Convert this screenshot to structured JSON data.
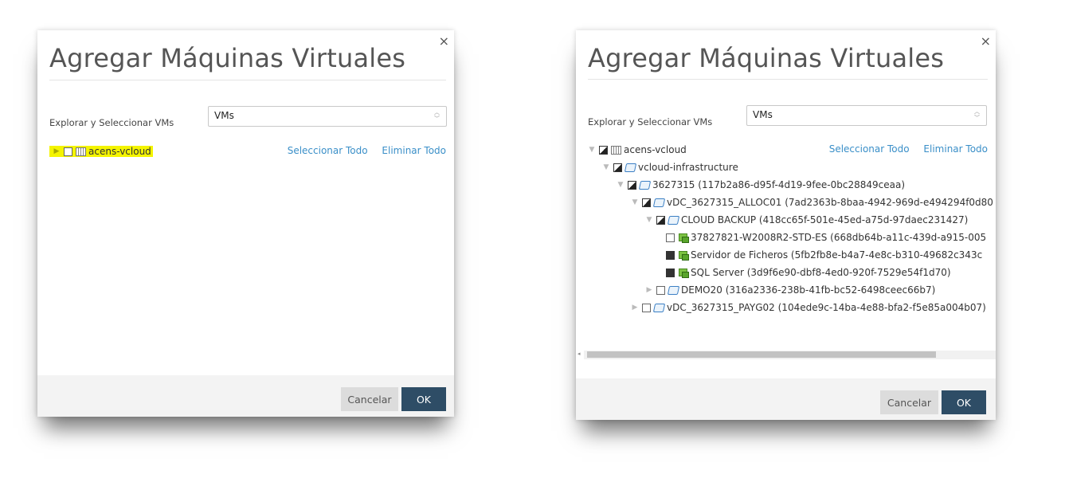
{
  "dialog_left": {
    "title": "Agregar Máquinas Virtuales",
    "close_label": "×",
    "field_label": "Explorar y Seleccionar VMs",
    "select_value": "VMs",
    "select_all": "Seleccionar Todo",
    "remove_all": "Eliminar Todo",
    "tree": [
      {
        "label": "acens-vcloud",
        "check": "empty",
        "expanded": false,
        "highlighted": true
      }
    ],
    "cancel": "Cancelar",
    "ok": "OK"
  },
  "dialog_right": {
    "title": "Agregar Máquinas Virtuales",
    "close_label": "×",
    "field_label": "Explorar y Seleccionar VMs",
    "select_value": "VMs",
    "select_all": "Seleccionar Todo",
    "remove_all": "Eliminar Todo",
    "tree": [
      {
        "label": "acens-vcloud",
        "check": "partial",
        "icon": "building-icon",
        "expanded": true
      },
      {
        "label": "vcloud-infrastructure",
        "check": "partial",
        "icon": "folder-icon",
        "expanded": true
      },
      {
        "label": "3627315 (117b2a86-d95f-4d19-9fee-0bc28849ceaa)",
        "check": "partial",
        "icon": "folder-icon",
        "expanded": true
      },
      {
        "label": "vDC_3627315_ALLOC01 (7ad2363b-8baa-4942-969d-e494294f0d80",
        "check": "partial",
        "icon": "folder-icon",
        "expanded": true
      },
      {
        "label": "CLOUD BACKUP (418cc65f-501e-45ed-a75d-97daec231427)",
        "check": "partial",
        "icon": "folder-icon",
        "expanded": true
      },
      {
        "label": "37827821-W2008R2-STD-ES (668db64b-a11c-439d-a915-005",
        "check": "empty",
        "icon": "vm-icon"
      },
      {
        "label": "Servidor de Ficheros (5fb2fb8e-b4a7-4e8c-b310-49682c343c",
        "check": "full",
        "icon": "vm-icon"
      },
      {
        "label": "SQL Server (3d9f6e90-dbf8-4ed0-920f-7529e54f1d70)",
        "check": "full",
        "icon": "vm-icon"
      },
      {
        "label": "DEMO20 (316a2336-238b-41fb-bc52-6498ceec66b7)",
        "check": "empty",
        "icon": "folder-icon",
        "expanded": false
      },
      {
        "label": "vDC_3627315_PAYG02 (104ede9c-14ba-4e88-bfa2-f5e85a004b07)",
        "check": "empty",
        "icon": "folder-icon",
        "expanded": false
      }
    ],
    "cancel": "Cancelar",
    "ok": "OK"
  }
}
